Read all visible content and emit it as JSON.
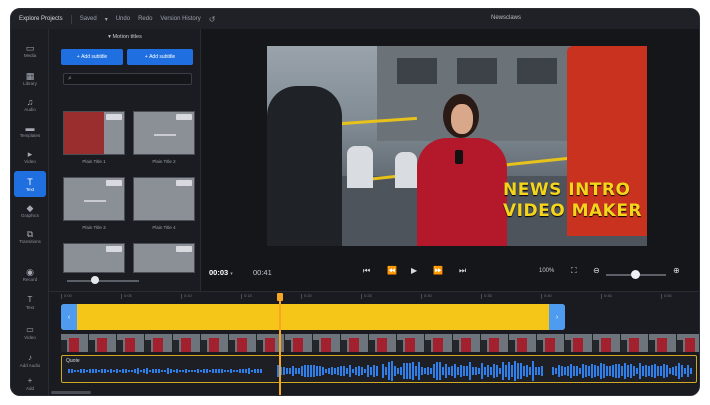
{
  "topbar": {
    "project_name": "Explore Projects",
    "tabs": [
      "Saved",
      "Undo",
      "Redo",
      "Version History"
    ],
    "center_title": "Newsclaws",
    "undo_icon": "undo-icon"
  },
  "rail": {
    "items": [
      {
        "label": "Media",
        "icon": "folder-icon"
      },
      {
        "label": "Library",
        "icon": "library-icon"
      },
      {
        "label": "Audio",
        "icon": "music-note-icon"
      },
      {
        "label": "Templates",
        "icon": "template-icon"
      },
      {
        "label": "Video",
        "icon": "video-icon"
      },
      {
        "label": "Text",
        "icon": "text-icon"
      },
      {
        "label": "Graphics",
        "icon": "shapes-icon"
      },
      {
        "label": "Transitions",
        "icon": "transition-icon"
      },
      {
        "label": "Record",
        "icon": "record-icon"
      }
    ],
    "active_index": 5
  },
  "panel": {
    "title": "Motion titles",
    "add_button": "Add subtitle",
    "add_button_2": "Add subtitle",
    "search_placeholder": "",
    "thumbnails": [
      {
        "label": "Plain Title 1"
      },
      {
        "label": "Plain Title 2"
      },
      {
        "label": "Plain Title 3"
      },
      {
        "label": "Plain Title 4"
      }
    ]
  },
  "preview": {
    "overlay_line1": "NEWS INTRO",
    "overlay_line2": "VIDEO MAKER",
    "time_current": "00:03",
    "time_current_suffix": "▾",
    "time_total": "00:41",
    "zoom": "100%"
  },
  "timeline": {
    "ruler_labels": [
      "0:00",
      "0:05",
      "0:10",
      "0:15",
      "0:20",
      "0:25",
      "0:30",
      "0:35",
      "0:40",
      "0:45",
      "0:50"
    ],
    "audio_label": "Quote",
    "rail_labels": [
      "Text",
      "Video",
      "Add Audio",
      "Add"
    ]
  },
  "colors": {
    "accent": "#1f6fe0",
    "text_clip": "#f5c518",
    "playhead": "#f5a623",
    "waveform": "#2f7fea",
    "overlay_text": "#f4d51b"
  }
}
